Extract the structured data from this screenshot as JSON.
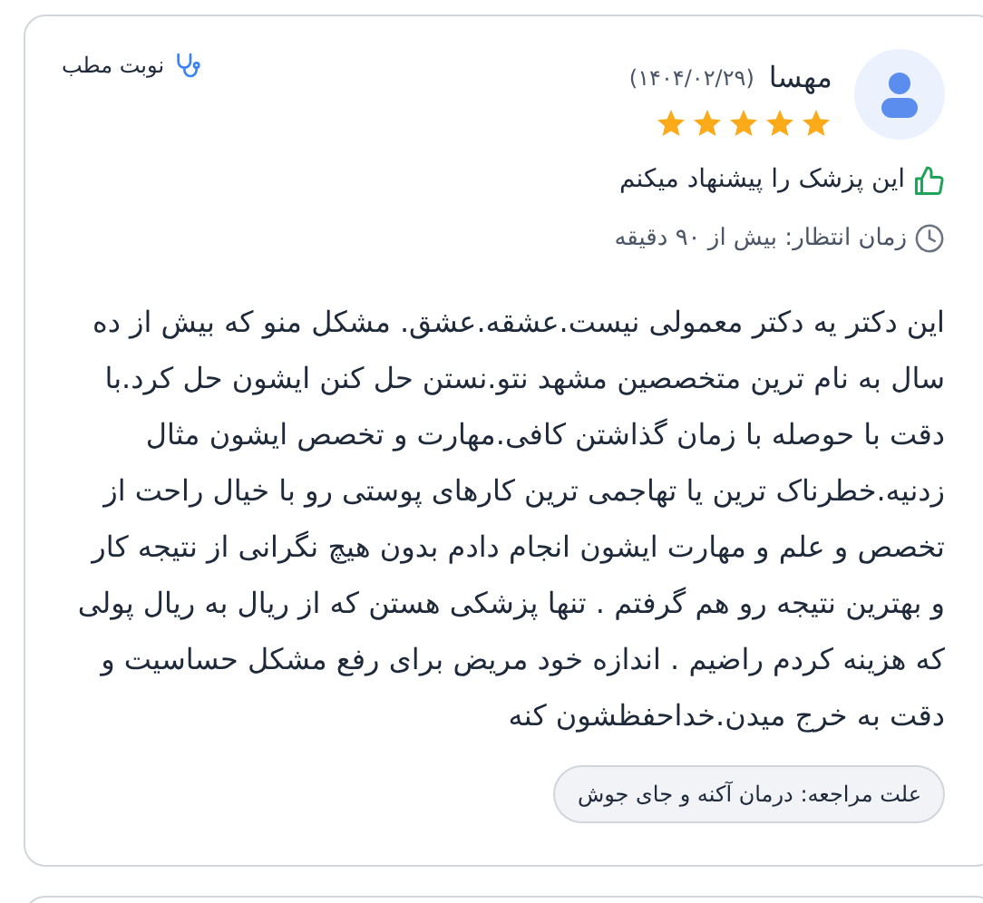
{
  "review": {
    "author": "مهسا",
    "date": "(۱۴۰۴/۰۲/۲۹)",
    "stars": 5,
    "visit_type": "نوبت مطب",
    "recommendation": "این پزشک را پیشنهاد میکنم",
    "wait_time": "زمان انتظار: بیش از ۹۰ دقیقه",
    "text": "این دکتر یه دکتر معمولی نیست.عشقه.عشق. مشکل منو که بیش از ده سال به نام ترین متخصصین مشهد نتو.نستن حل کنن ایشون حل کرد.با دقت با حوصله با زمان گذاشتن کافی.مهارت و تخصص ایشون مثال زدنیه.خطرناک ترین یا تهاجمی ترین کارهای پوستی رو با خیال راحت از تخصص و علم و مهارت ایشون انجام دادم بدون هیچ نگرانی از نتیجه کار و بهترین نتیجه رو هم گرفتم . تنها پزشکی هستن که از ریال به ریال پولی که هزینه کردم راضیم . اندازه خود مریض برای رفع مشکل حساسیت و دقت به خرج میدن.خداحفظشون کنه",
    "reason_tag": "علت مراجعه: درمان آکنه و جای جوش"
  }
}
